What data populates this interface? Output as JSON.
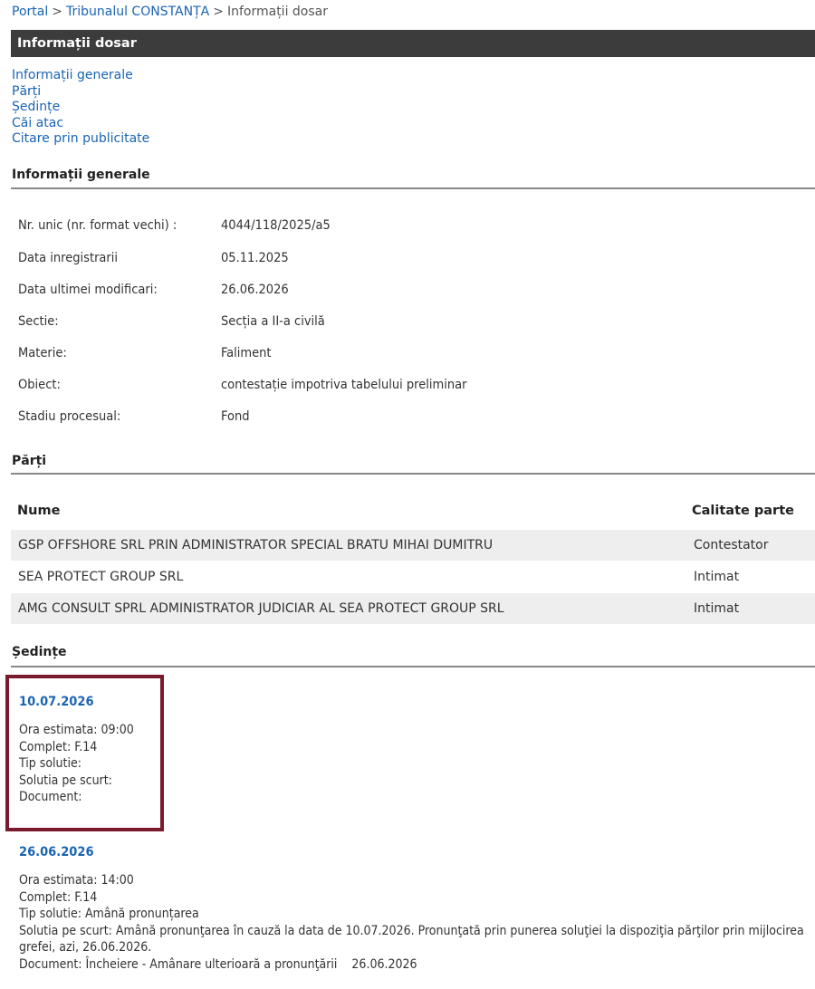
{
  "breadcrumb": {
    "items": [
      "Portal",
      "Tribunalul CONSTANȚA",
      "Informații dosar"
    ],
    "separator": ">"
  },
  "page_title": "Informații dosar",
  "nav": [
    "Informații generale",
    "Părți",
    "Ședințe",
    "Căi atac",
    "Citare prin publicitate"
  ],
  "general": {
    "heading": "Informații generale",
    "rows": [
      {
        "label": "Nr. unic (nr. format vechi) :",
        "value": "4044/118/2025/a5"
      },
      {
        "label": "Data inregistrarii",
        "value": "05.11.2025"
      },
      {
        "label": "Data ultimei modificari:",
        "value": "26.06.2026"
      },
      {
        "label": "Sectie:",
        "value": "Secția a II-a civilă"
      },
      {
        "label": "Materie:",
        "value": "Faliment"
      },
      {
        "label": "Obiect:",
        "value": "contestație impotriva tabelului preliminar"
      },
      {
        "label": "Stadiu procesual:",
        "value": "Fond"
      }
    ]
  },
  "parties": {
    "heading": "Părți",
    "columns": [
      "Nume",
      "Calitate parte"
    ],
    "rows": [
      {
        "name": "GSP OFFSHORE SRL PRIN ADMINISTRATOR SPECIAL BRATU MIHAI DUMITRU",
        "role": "Contestator"
      },
      {
        "name": "SEA PROTECT GROUP SRL",
        "role": "Intimat"
      },
      {
        "name": "AMG CONSULT SPRL ADMINISTRATOR JUDICIAR AL SEA PROTECT GROUP SRL",
        "role": "Intimat"
      }
    ]
  },
  "hearings": {
    "heading": "Ședințe",
    "items": [
      {
        "date": "10.07.2026",
        "ora": "Ora estimata: 09:00",
        "complet": "Complet: F.14",
        "tip": "Tip solutie:",
        "solutie": "Solutia pe scurt:",
        "document": "Document:"
      },
      {
        "date": "26.06.2026",
        "ora": "Ora estimata: 14:00",
        "complet": "Complet: F.14",
        "tip": "Tip solutie: Amână pronunțarea",
        "solutie": "Solutia pe scurt: Amână pronunţarea în cauză la data de 10.07.2026. Pronunţată prin punerea soluţiei la dispoziţia părţilor prin mijlocirea grefei, azi, 26.06.2026.",
        "document": "Document: Încheiere - Amânare ulterioară a pronunţării    26.06.2026"
      }
    ]
  },
  "colors": {
    "link": "#1a64b4",
    "title_bar": "#3c3c3c",
    "highlight": "#7a1a2e",
    "row_shade": "#eeeeee"
  }
}
